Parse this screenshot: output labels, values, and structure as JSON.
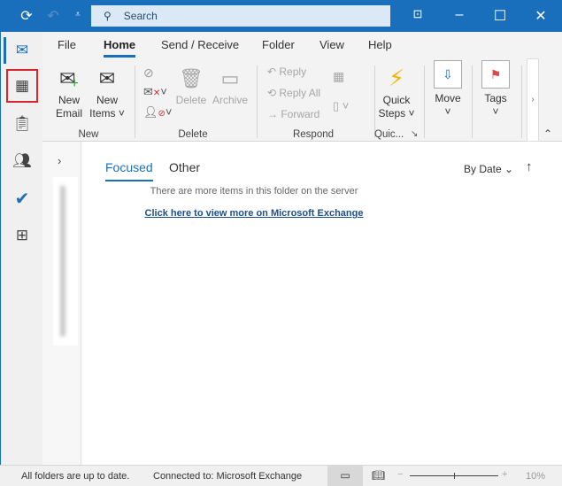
{
  "titlebar": {
    "search_placeholder": "Search"
  },
  "ribbon": {
    "tabs": [
      "File",
      "Home",
      "Send / Receive",
      "Folder",
      "View",
      "Help"
    ],
    "new": {
      "new_email": [
        "New",
        "Email"
      ],
      "new_items": [
        "New",
        "Items ˅"
      ],
      "group": "New"
    },
    "delete": {
      "delete": "Delete",
      "archive": "Archive",
      "group": "Delete"
    },
    "respond": {
      "reply": "Reply",
      "reply_all": "Reply All",
      "forward": "Forward",
      "group": "Respond"
    },
    "quick": {
      "label": [
        "Quick",
        "Steps ˅"
      ],
      "group": "Quic..."
    },
    "move": {
      "label": "Move"
    },
    "tags": {
      "label": "Tags"
    }
  },
  "mail": {
    "tabs": [
      "Focused",
      "Other"
    ],
    "sort": "By Date",
    "notice": "There are more items in this folder on the server",
    "link": "Click here to view more on Microsoft Exchange"
  },
  "status": {
    "sync": "All folders are up to date.",
    "connection": "Connected to: Microsoft Exchange",
    "zoom": "10%"
  },
  "colors": {
    "accent": "#1a6fbd",
    "highlight": "#d9262c"
  }
}
